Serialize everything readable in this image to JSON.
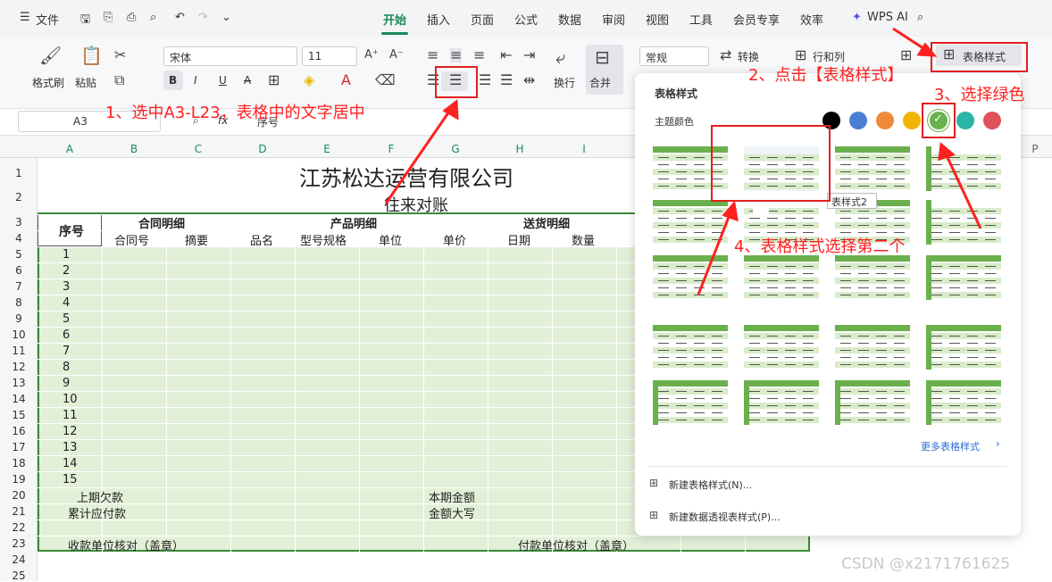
{
  "menu": {
    "file": "文件",
    "tabs": [
      "开始",
      "插入",
      "页面",
      "公式",
      "数据",
      "审阅",
      "视图",
      "工具",
      "会员专享",
      "效率"
    ],
    "wps_ai": "WPS AI"
  },
  "ribbon": {
    "format_painter": "格式刷",
    "paste": "粘贴",
    "font_name": "宋体",
    "font_size": "11",
    "bold": "B",
    "italic": "I",
    "underline": "U",
    "strike": "A",
    "wrap": "换行",
    "merge": "合并",
    "number_format": "常规",
    "convert": "转换",
    "rows_cols": "行和列",
    "table_style": "表格样式"
  },
  "formula": {
    "name_box": "A3",
    "fx": "fx",
    "content": "序号"
  },
  "columns": [
    "A",
    "B",
    "C",
    "D",
    "E",
    "F",
    "G",
    "H",
    "I",
    "P"
  ],
  "rows": [
    "1",
    "2",
    "3",
    "4",
    "5",
    "6",
    "7",
    "8",
    "9",
    "10",
    "11",
    "12",
    "13",
    "14",
    "15",
    "16",
    "17",
    "18",
    "19",
    "20",
    "21",
    "22",
    "23",
    "24",
    "25"
  ],
  "sheet": {
    "title": "江苏松达运营有限公司",
    "subtitle": "往来对账",
    "h_seq": "序号",
    "h_contract": "合同明细",
    "h_product": "产品明细",
    "h_delivery": "送货明细",
    "h_contract_no": "合同号",
    "h_summary": "摘要",
    "h_pname": "品名",
    "h_model": "型号规格",
    "h_unit": "单位",
    "h_price": "单价",
    "h_date": "日期",
    "h_qty": "数量",
    "nums": [
      "1",
      "2",
      "3",
      "4",
      "5",
      "6",
      "7",
      "8",
      "9",
      "10",
      "11",
      "12",
      "13",
      "14",
      "15"
    ],
    "prev_due": "上期欠款",
    "cur_amount": "本期金额",
    "total_payable": "累计应付款",
    "amount_upper": "金额大写",
    "recv_confirm": "收款单位核对（盖章）",
    "pay_confirm": "付款单位核对（盖章）"
  },
  "panel": {
    "title": "表格样式",
    "theme_colors": "主题颜色",
    "tooltip": "表样式2",
    "more": "更多表格样式",
    "new_style": "新建表格样式(N)...",
    "new_pivot": "新建数据透视表样式(P)..."
  },
  "theme_swatches": [
    "#000000",
    "#4a7fd4",
    "#ef8a3a",
    "#f2b400",
    "#6ab04c",
    "#2ab5a5",
    "#e0505a"
  ],
  "annotations": {
    "a1": "1、选中A3-L23，表格中的文字居中",
    "a2": "2、点击【表格样式】",
    "a3": "3、选择绿色",
    "a4": "4、表格样式选择第二个"
  },
  "watermark": "CSDN @x2171761625"
}
